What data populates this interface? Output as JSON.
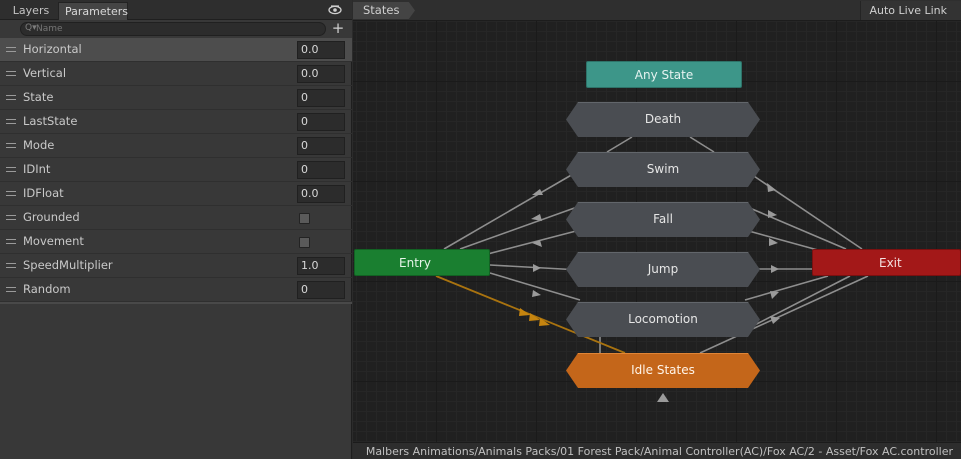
{
  "left_panel": {
    "tabs": [
      {
        "label": "Layers",
        "active": false
      },
      {
        "label": "Parameters",
        "active": true
      }
    ],
    "eye_icon": "eye-icon",
    "search": {
      "prefix": "Q▾",
      "placeholder": "Name"
    },
    "add_label": "+",
    "parameters": [
      {
        "name": "Horizontal",
        "type": "float",
        "value": "0.0",
        "selected": true
      },
      {
        "name": "Vertical",
        "type": "float",
        "value": "0.0"
      },
      {
        "name": "State",
        "type": "int",
        "value": "0"
      },
      {
        "name": "LastState",
        "type": "int",
        "value": "0"
      },
      {
        "name": "Mode",
        "type": "int",
        "value": "0"
      },
      {
        "name": "IDInt",
        "type": "int",
        "value": "0"
      },
      {
        "name": "IDFloat",
        "type": "float",
        "value": "0.0"
      },
      {
        "name": "Grounded",
        "type": "bool",
        "value": false
      },
      {
        "name": "Movement",
        "type": "bool",
        "value": false
      },
      {
        "name": "SpeedMultiplier",
        "type": "float",
        "value": "1.0"
      },
      {
        "name": "Random",
        "type": "int",
        "value": "0"
      }
    ]
  },
  "graph": {
    "breadcrumb": "States",
    "auto_live_link": "Auto Live Link",
    "nodes": {
      "any_state": "Any State",
      "entry": "Entry",
      "exit": "Exit",
      "death": "Death",
      "swim": "Swim",
      "fall": "Fall",
      "jump": "Jump",
      "locomotion": "Locomotion",
      "idle_states": "Idle States"
    },
    "colors": {
      "any_state": "#3d9689",
      "entry": "#1a7f30",
      "exit": "#a31818",
      "state": "#4a4d52",
      "default_state": "#c4661a",
      "default_transition": "#b37a12",
      "transition": "#9a9a9a"
    }
  },
  "status_bar": {
    "path": "Malbers Animations/Animals Packs/01 Forest Pack/Animal Controller(AC)/Fox AC/2 - Asset/Fox AC.controller"
  }
}
